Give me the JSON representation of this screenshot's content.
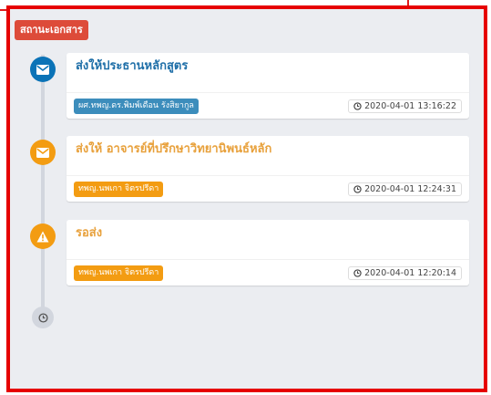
{
  "status_title": "สถานะเอกสาร",
  "timeline": [
    {
      "title": "ส่งให้ประธานหลักสูตร",
      "person": "ผศ.ทพญ.ดร.พิมพ์เดือน รังสิยากูล",
      "time": "2020-04-01 13:16:22",
      "icon": "envelope-icon",
      "color": "#0b73b7"
    },
    {
      "title": "ส่งให้ อาจารย์ที่ปรึกษาวิทยานิพนธ์หลัก",
      "person": "ทพญ.นพเกา จิตรปรีดา",
      "time": "2020-04-01 12:24:31",
      "icon": "envelope-icon",
      "color": "#f39c12"
    },
    {
      "title": "รอส่ง",
      "person": "ทพญ.นพเกา จิตรปรีดา",
      "time": "2020-04-01 12:20:14",
      "icon": "warning-icon",
      "color": "#f39c12"
    }
  ],
  "end_icon": "clock-icon"
}
